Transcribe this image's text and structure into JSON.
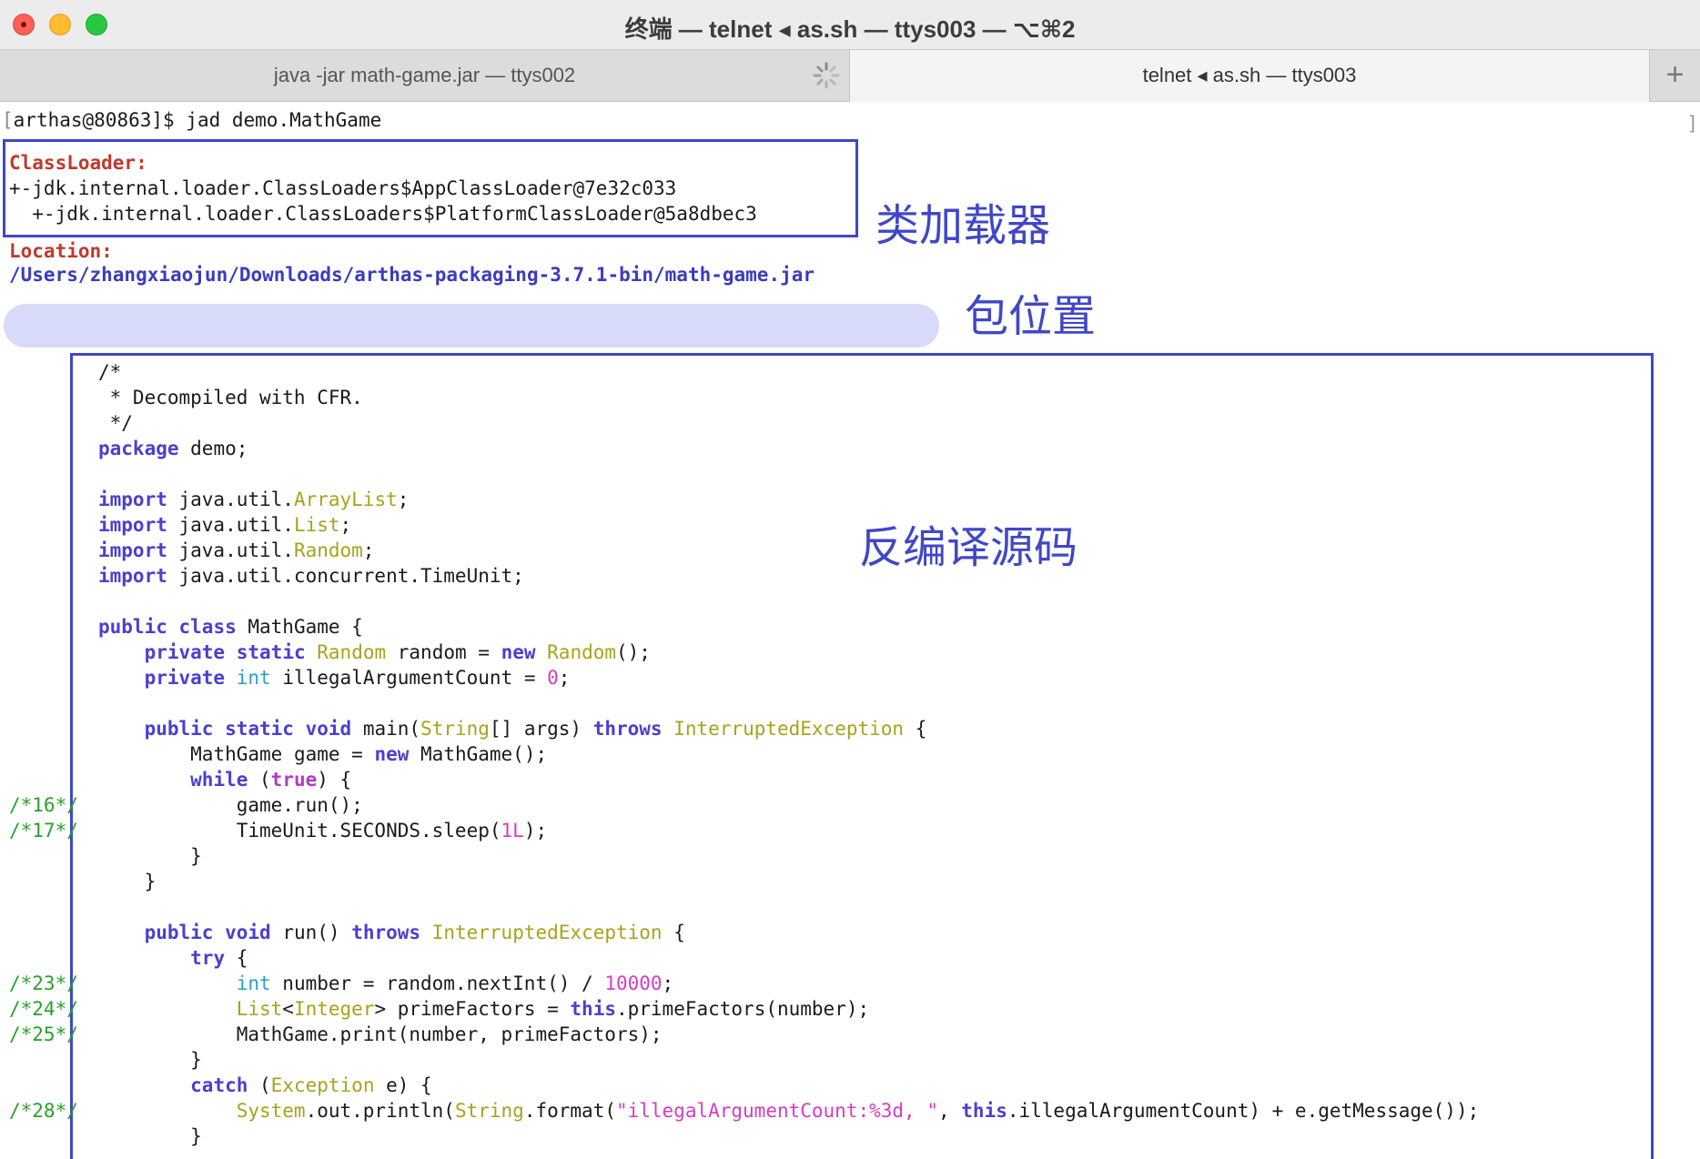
{
  "window": {
    "title": "终端 — telnet ◂ as.sh — ttys003 — ⌥⌘2"
  },
  "tabs": [
    {
      "label": "java -jar math-game.jar — ttys002"
    },
    {
      "label": "telnet ◂ as.sh — ttys003"
    }
  ],
  "tab_add_label": "+",
  "terminal": {
    "prompt_open": "[",
    "prompt_rest": "arthas@80863]$ jad demo.MathGame",
    "right_bracket": "]",
    "classloader_label": "ClassLoader:",
    "classloader_lines": [
      "+-jdk.internal.loader.ClassLoaders$AppClassLoader@7e32c033",
      "  +-jdk.internal.loader.ClassLoaders$PlatformClassLoader@5a8dbec3"
    ],
    "location_label": "Location:",
    "location_path": "/Users/zhangxiaojun/Downloads/arthas-packaging-3.7.1-bin/math-game.jar"
  },
  "annotations": {
    "classloader": "类加载器",
    "location": "包位置",
    "source": "反编译源码"
  },
  "line_numbers": {
    "l16": "/*16*/",
    "l17": "/*17*/",
    "l23": "/*23*/",
    "l24": "/*24*/",
    "l25": "/*25*/",
    "l28": "/*28*/"
  },
  "code": {
    "c_open": "/*",
    "c_body": " * Decompiled with CFR.",
    "c_close": " */",
    "package_kw": "package",
    "package_name": " demo;",
    "import_kw": "import",
    "imp1_pkg": " java.util.",
    "imp1_cls": "ArrayList",
    "imp2_cls": "List",
    "imp3_cls": "Random",
    "imp4_rest": " java.util.concurrent.TimeUnit;",
    "semi": ";",
    "public_kw": "public",
    "class_kw": "class",
    "class_name": " MathGame {",
    "private_kw": "private",
    "static_kw": "static",
    "random_type": "Random",
    "random_decl": " random = ",
    "new_kw": "new",
    "random_ctor": "Random",
    "random_end": "();",
    "int_kw": "int",
    "illegal_decl": " illegalArgumentCount = ",
    "zero": "0",
    "void_kw": "void",
    "main_sig": " main(",
    "string_type": "String",
    "main_args": "[] args) ",
    "throws_kw": "throws",
    "interrupted": "InterruptedException",
    "open_brace": " {",
    "game_decl": "MathGame game = ",
    "game_ctor": " MathGame();",
    "while_kw": "while",
    "paren_open": " (",
    "true_kw": "true",
    "paren_close_brace": ") {",
    "game_run": "game.run();",
    "sleep_pre": "TimeUnit.SECONDS.sleep(",
    "one_l": "1L",
    "sleep_end": ");",
    "close_brace": "}",
    "run_sig": " run() ",
    "try_kw": "try",
    "number_decl": " number = random.nextInt() / ",
    "ten_thousand": "10000",
    "list_type": "List",
    "lt": "<",
    "integer_type": "Integer",
    "prime_decl": "> primeFactors = ",
    "this_kw": "this",
    "prime_call": ".primeFactors(number);",
    "print_call": "MathGame.print(number, primeFactors);",
    "catch_kw": "catch",
    "exception_type": "Exception",
    "catch_end": " e) {",
    "system_type": "System",
    "println_pre": ".out.println(",
    "format_call": ".format(",
    "format_str": "\"illegalArgumentCount:%3d, \"",
    "comma_sp": ", ",
    "println_end": ".illegalArgumentCount) + e.getMessage());"
  }
}
